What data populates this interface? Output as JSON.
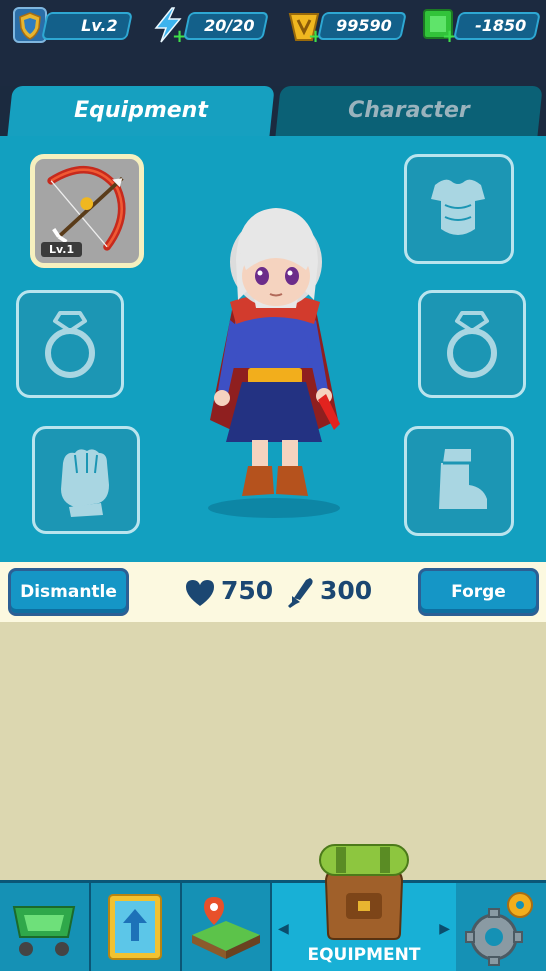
{
  "top_stats": {
    "level": "Lv.2",
    "energy": "20/20",
    "gold": "99590",
    "gems": "-1850"
  },
  "tabs": {
    "equipment": "Equipment",
    "character": "Character"
  },
  "slots": {
    "weapon": {
      "level": "Lv.1"
    }
  },
  "stats": {
    "dismantle_label": "Dismantle",
    "hp": "750",
    "attack": "300",
    "forge_label": "Forge"
  },
  "nav": {
    "active_label": "EQUIPMENT"
  },
  "colors": {
    "panel": "#12a0c0",
    "background": "#1c2a40",
    "button": "#1596c6",
    "content": "#dcd7b0"
  }
}
